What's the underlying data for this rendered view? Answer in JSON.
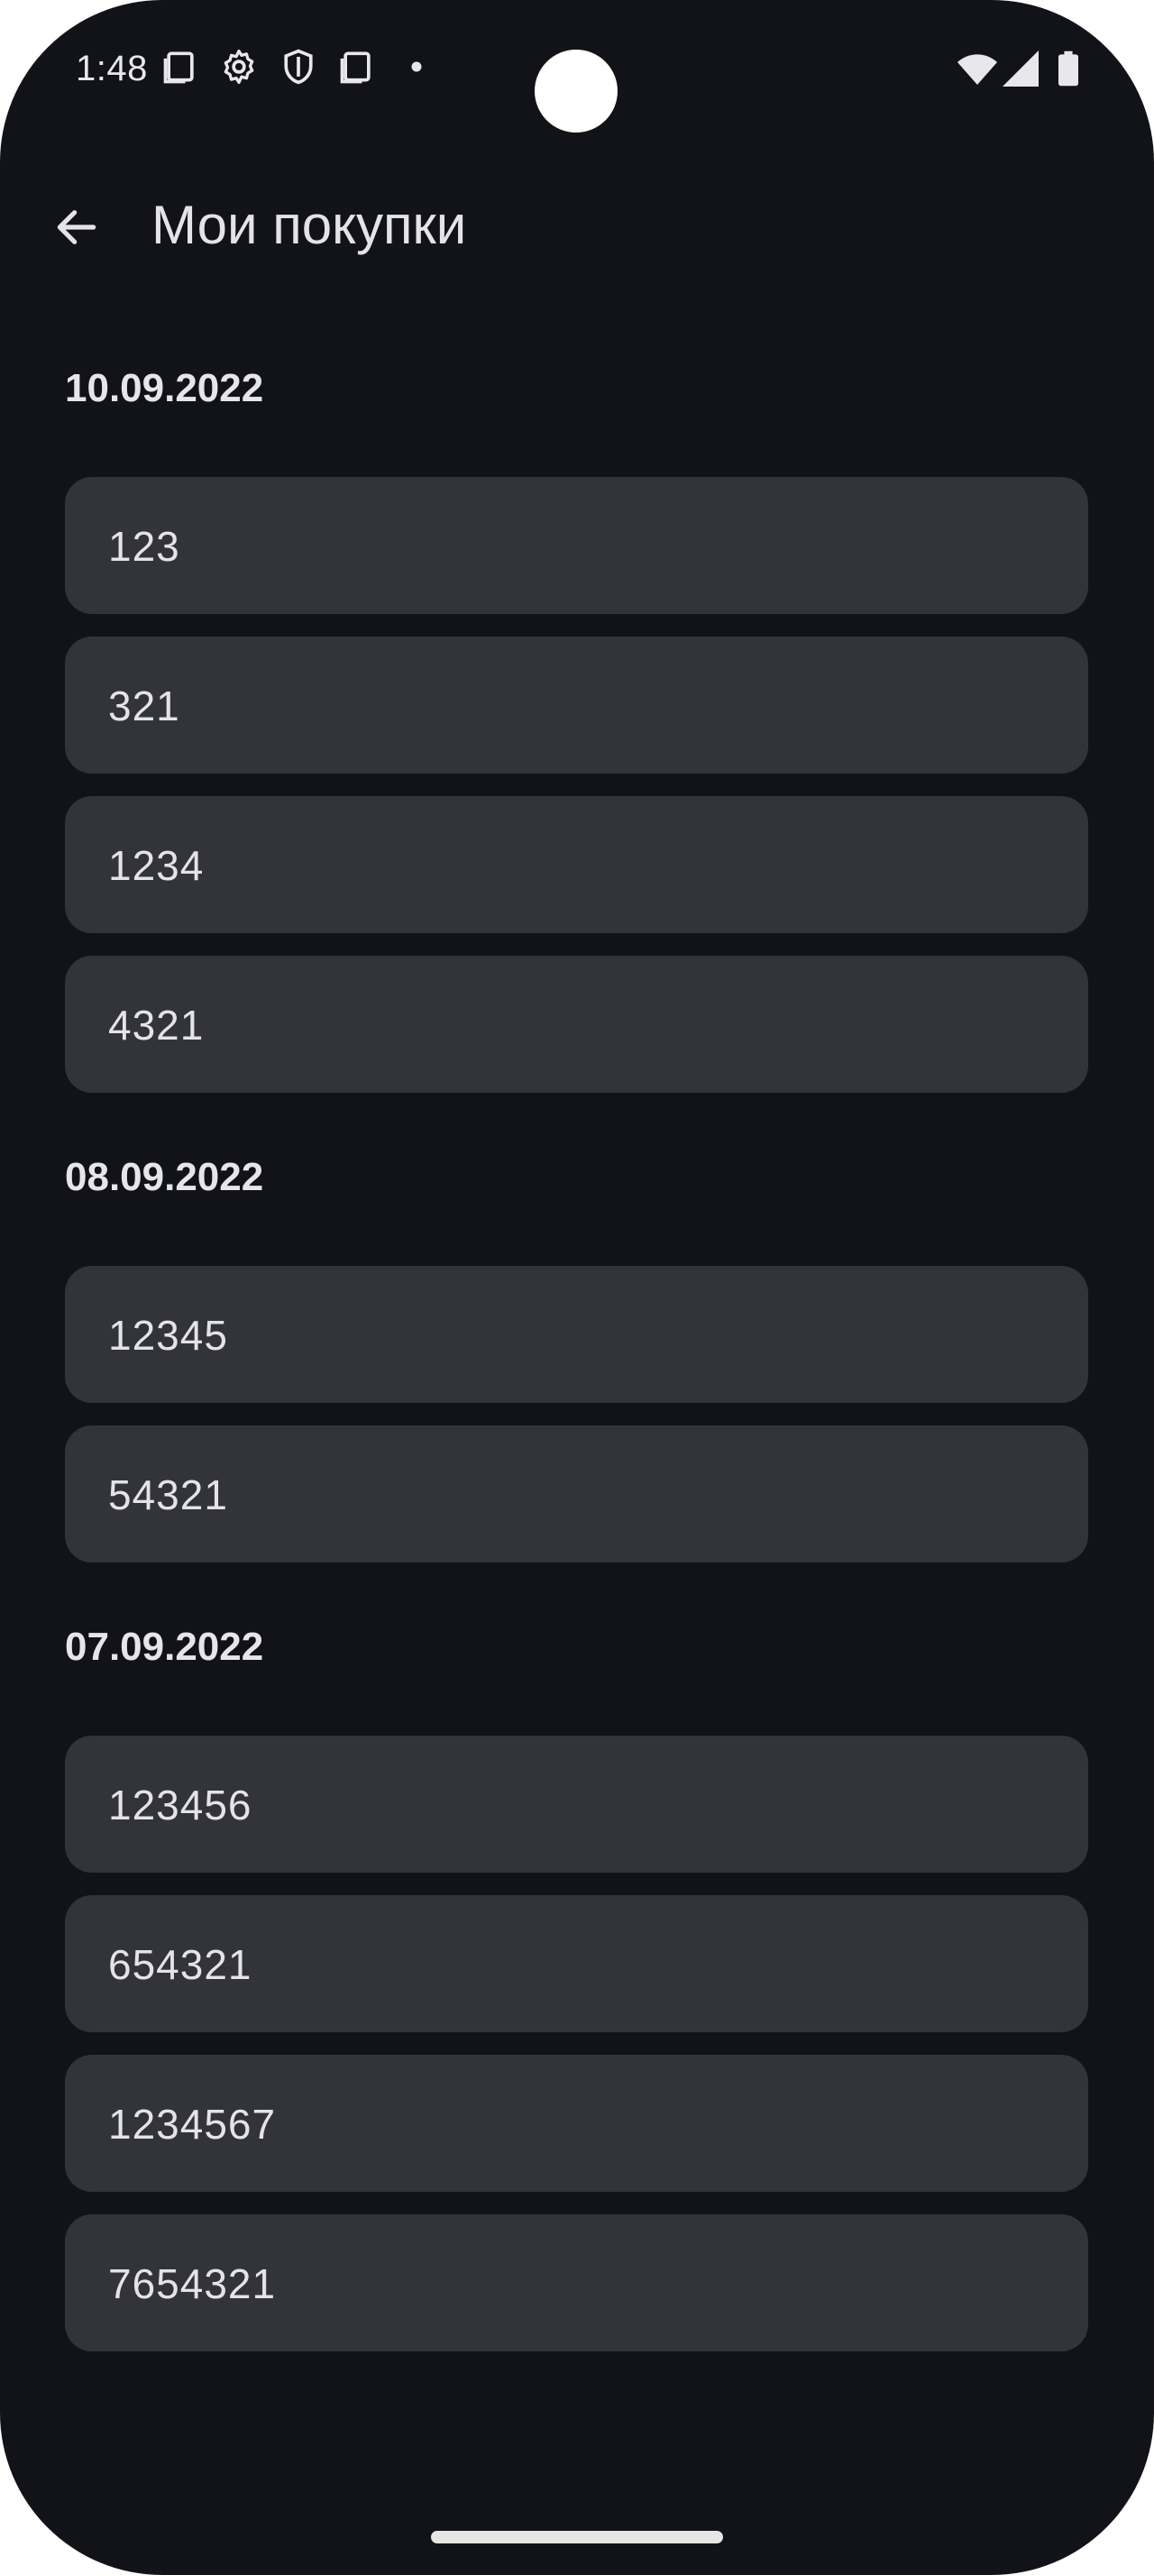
{
  "status_bar": {
    "time": "1:48",
    "left_icons": [
      "screenshot-icon",
      "settings-icon",
      "shield-icon",
      "screenshot-icon",
      "notification-dot-icon"
    ],
    "right_icons": [
      "wifi-icon",
      "cellular-signal-icon",
      "battery-icon"
    ]
  },
  "app_bar": {
    "back_icon": "arrow-back-icon",
    "title": "Мои покупки"
  },
  "groups": [
    {
      "date": "10.09.2022",
      "items": [
        "123",
        "321",
        "1234",
        "4321"
      ]
    },
    {
      "date": "08.09.2022",
      "items": [
        "12345",
        "54321"
      ]
    },
    {
      "date": "07.09.2022",
      "items": [
        "123456",
        "654321",
        "1234567",
        "7654321"
      ]
    }
  ],
  "colors": {
    "background": "#121318",
    "card": "#333439",
    "text": "#e4e4e8"
  }
}
